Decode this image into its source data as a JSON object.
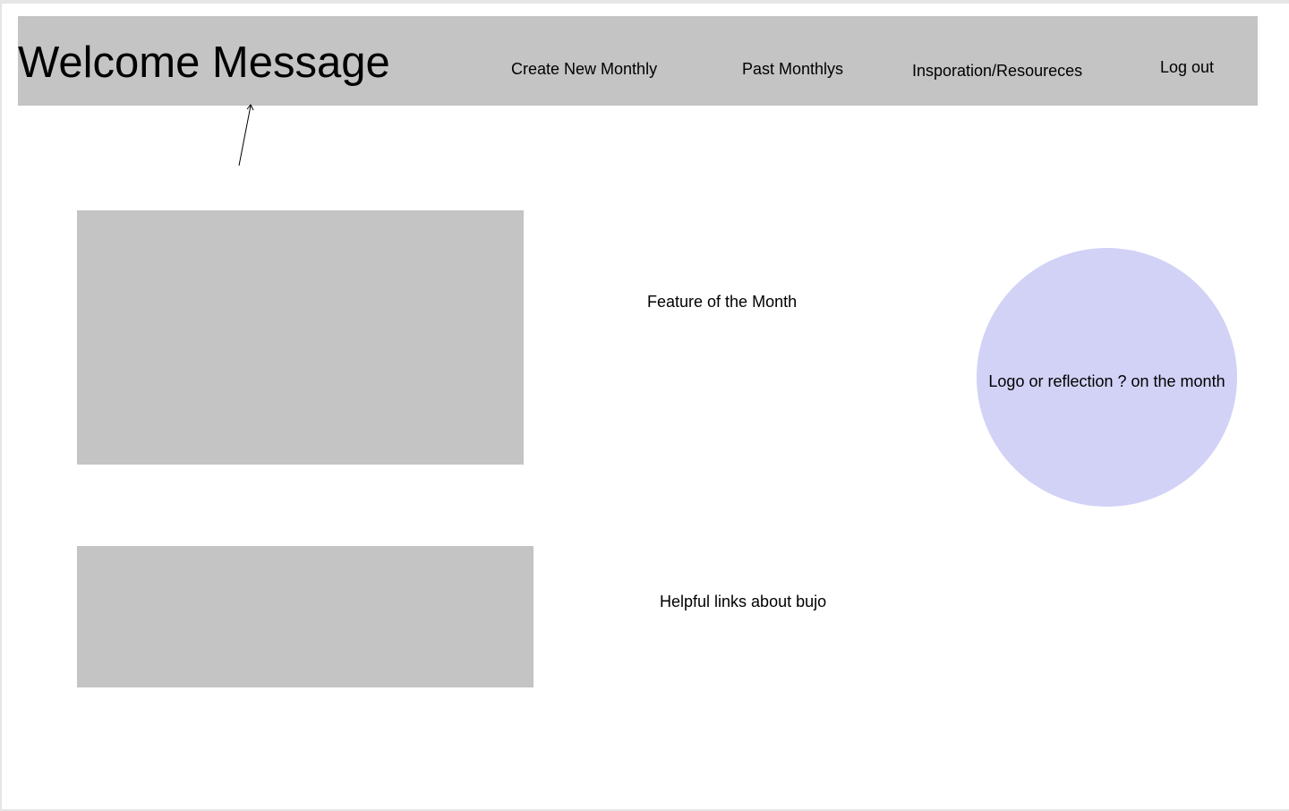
{
  "header": {
    "welcome": "Welcome Message",
    "nav": {
      "create": "Create New Monthly",
      "past": "Past Monthlys",
      "inspiration": "Insporation/Resoureces",
      "logout": "Log out"
    }
  },
  "main": {
    "feature_label": "Feature of the Month",
    "links_label": "Helpful links about bujo",
    "logo_text": "Logo or reflection ? on the month"
  },
  "colors": {
    "placeholder_gray": "#c4c4c4",
    "circle_lavender": "#d2d2f7"
  }
}
